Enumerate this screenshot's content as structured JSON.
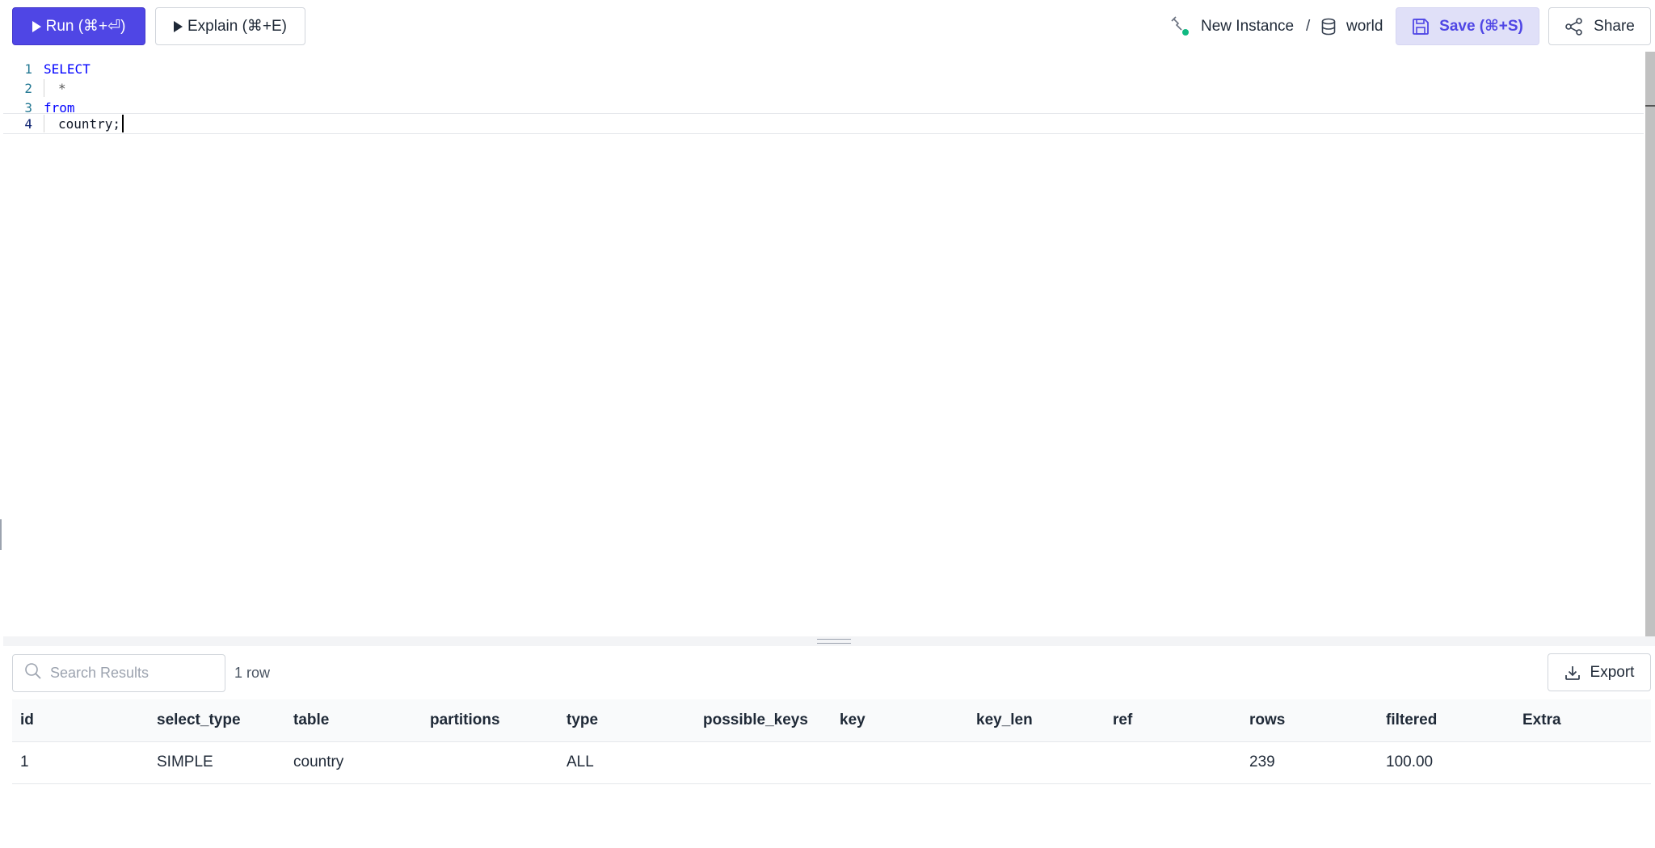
{
  "toolbar": {
    "run_label": "Run (⌘+⏎)",
    "explain_label": "Explain (⌘+E)",
    "instance_label": "New Instance",
    "separator": "/",
    "database_label": "world",
    "save_label": "Save (⌘+S)",
    "share_label": "Share"
  },
  "editor": {
    "lines": [
      {
        "number": "1",
        "text": "SELECT"
      },
      {
        "number": "2",
        "text": "*"
      },
      {
        "number": "3",
        "text": "from"
      },
      {
        "number": "4",
        "text": "country;"
      }
    ]
  },
  "results": {
    "search_placeholder": "Search Results",
    "row_count": "1 row",
    "export_label": "Export",
    "columns": [
      "id",
      "select_type",
      "table",
      "partitions",
      "type",
      "possible_keys",
      "key",
      "key_len",
      "ref",
      "rows",
      "filtered",
      "Extra"
    ],
    "rows": [
      [
        "1",
        "SIMPLE",
        "country",
        "",
        "ALL",
        "",
        "",
        "",
        "",
        "239",
        "100.00",
        ""
      ]
    ]
  },
  "colors": {
    "accent": "#4f46e5",
    "save_bg": "#e0e0f8",
    "instance_status": "#10b981"
  },
  "icons": {
    "run": "play-icon",
    "explain": "play-icon",
    "instance": "connection-icon",
    "database": "database-icon",
    "save": "save-icon",
    "share": "share-icon",
    "search": "search-icon",
    "export": "download-icon"
  }
}
